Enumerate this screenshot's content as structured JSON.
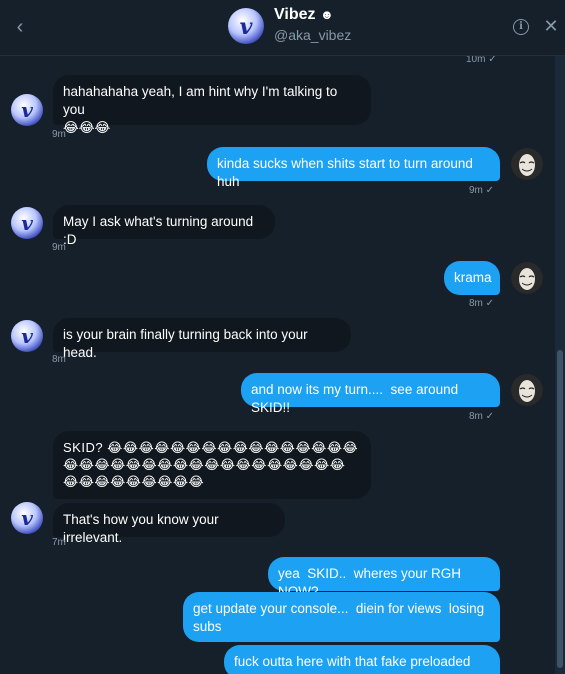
{
  "header": {
    "name": "Vibez",
    "badge": "☻",
    "handle": "@aka_vibez",
    "back_icon": "chevron-left-icon",
    "info_icon": "info-icon",
    "close_icon": "close-icon"
  },
  "messages": [
    {
      "side": "out",
      "text": "",
      "time": "10m ✓"
    },
    {
      "side": "in",
      "text": "hahahahaha yeah, I am hint why I'm talking to you\n😂😂😂",
      "time": "9m"
    },
    {
      "side": "out",
      "text": "kinda sucks when shits start to turn around huh",
      "time": "9m ✓"
    },
    {
      "side": "in",
      "text": "May I ask what's turning around :D",
      "time": "9m"
    },
    {
      "side": "out",
      "text": "krama",
      "time": "8m ✓"
    },
    {
      "side": "in",
      "text": "is your brain finally turning back into your head.",
      "time": "8m"
    },
    {
      "side": "out",
      "text": "and now its my turn....  see around SKID!!",
      "time": "8m ✓"
    },
    {
      "side": "in",
      "text": "SKID? 😂😂😂😂😂😂😂😂😂😂😂😂😂😂😂😂😂😂😂😂😂😂😂😂😂😂😂😂😂😂😂😂😂😂😂😂😂😂😂😂😂😂😂",
      "time": ""
    },
    {
      "side": "in",
      "text": "That's how you know your irrelevant.",
      "time": "7m"
    },
    {
      "side": "out",
      "text": "yea  SKID..  wheres your RGH NOW?",
      "time": ""
    },
    {
      "side": "out",
      "text": "get update your console...  diein for views  losing\nsubs",
      "time": ""
    },
    {
      "side": "out",
      "text": "fuck outta here with that fake preloaded ass",
      "time": ""
    }
  ],
  "colors": {
    "background": "#15202b",
    "incoming_bubble": "#10171e",
    "outgoing_bubble": "#1da1f2",
    "muted_text": "#8899a6"
  }
}
